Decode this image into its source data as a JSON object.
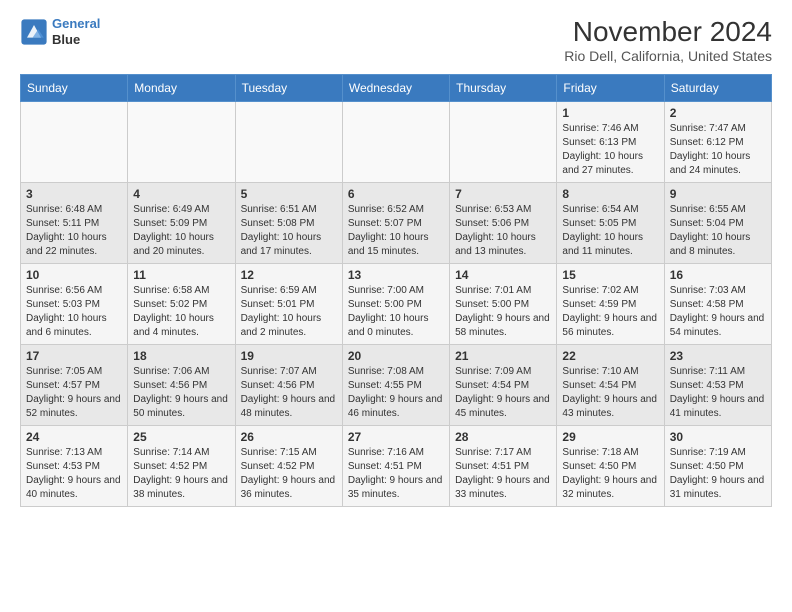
{
  "header": {
    "logo_line1": "General",
    "logo_line2": "Blue",
    "title": "November 2024",
    "subtitle": "Rio Dell, California, United States"
  },
  "weekdays": [
    "Sunday",
    "Monday",
    "Tuesday",
    "Wednesday",
    "Thursday",
    "Friday",
    "Saturday"
  ],
  "weeks": [
    [
      {
        "day": "",
        "info": ""
      },
      {
        "day": "",
        "info": ""
      },
      {
        "day": "",
        "info": ""
      },
      {
        "day": "",
        "info": ""
      },
      {
        "day": "",
        "info": ""
      },
      {
        "day": "1",
        "info": "Sunrise: 7:46 AM\nSunset: 6:13 PM\nDaylight: 10 hours and 27 minutes."
      },
      {
        "day": "2",
        "info": "Sunrise: 7:47 AM\nSunset: 6:12 PM\nDaylight: 10 hours and 24 minutes."
      }
    ],
    [
      {
        "day": "3",
        "info": "Sunrise: 6:48 AM\nSunset: 5:11 PM\nDaylight: 10 hours and 22 minutes."
      },
      {
        "day": "4",
        "info": "Sunrise: 6:49 AM\nSunset: 5:09 PM\nDaylight: 10 hours and 20 minutes."
      },
      {
        "day": "5",
        "info": "Sunrise: 6:51 AM\nSunset: 5:08 PM\nDaylight: 10 hours and 17 minutes."
      },
      {
        "day": "6",
        "info": "Sunrise: 6:52 AM\nSunset: 5:07 PM\nDaylight: 10 hours and 15 minutes."
      },
      {
        "day": "7",
        "info": "Sunrise: 6:53 AM\nSunset: 5:06 PM\nDaylight: 10 hours and 13 minutes."
      },
      {
        "day": "8",
        "info": "Sunrise: 6:54 AM\nSunset: 5:05 PM\nDaylight: 10 hours and 11 minutes."
      },
      {
        "day": "9",
        "info": "Sunrise: 6:55 AM\nSunset: 5:04 PM\nDaylight: 10 hours and 8 minutes."
      }
    ],
    [
      {
        "day": "10",
        "info": "Sunrise: 6:56 AM\nSunset: 5:03 PM\nDaylight: 10 hours and 6 minutes."
      },
      {
        "day": "11",
        "info": "Sunrise: 6:58 AM\nSunset: 5:02 PM\nDaylight: 10 hours and 4 minutes."
      },
      {
        "day": "12",
        "info": "Sunrise: 6:59 AM\nSunset: 5:01 PM\nDaylight: 10 hours and 2 minutes."
      },
      {
        "day": "13",
        "info": "Sunrise: 7:00 AM\nSunset: 5:00 PM\nDaylight: 10 hours and 0 minutes."
      },
      {
        "day": "14",
        "info": "Sunrise: 7:01 AM\nSunset: 5:00 PM\nDaylight: 9 hours and 58 minutes."
      },
      {
        "day": "15",
        "info": "Sunrise: 7:02 AM\nSunset: 4:59 PM\nDaylight: 9 hours and 56 minutes."
      },
      {
        "day": "16",
        "info": "Sunrise: 7:03 AM\nSunset: 4:58 PM\nDaylight: 9 hours and 54 minutes."
      }
    ],
    [
      {
        "day": "17",
        "info": "Sunrise: 7:05 AM\nSunset: 4:57 PM\nDaylight: 9 hours and 52 minutes."
      },
      {
        "day": "18",
        "info": "Sunrise: 7:06 AM\nSunset: 4:56 PM\nDaylight: 9 hours and 50 minutes."
      },
      {
        "day": "19",
        "info": "Sunrise: 7:07 AM\nSunset: 4:56 PM\nDaylight: 9 hours and 48 minutes."
      },
      {
        "day": "20",
        "info": "Sunrise: 7:08 AM\nSunset: 4:55 PM\nDaylight: 9 hours and 46 minutes."
      },
      {
        "day": "21",
        "info": "Sunrise: 7:09 AM\nSunset: 4:54 PM\nDaylight: 9 hours and 45 minutes."
      },
      {
        "day": "22",
        "info": "Sunrise: 7:10 AM\nSunset: 4:54 PM\nDaylight: 9 hours and 43 minutes."
      },
      {
        "day": "23",
        "info": "Sunrise: 7:11 AM\nSunset: 4:53 PM\nDaylight: 9 hours and 41 minutes."
      }
    ],
    [
      {
        "day": "24",
        "info": "Sunrise: 7:13 AM\nSunset: 4:53 PM\nDaylight: 9 hours and 40 minutes."
      },
      {
        "day": "25",
        "info": "Sunrise: 7:14 AM\nSunset: 4:52 PM\nDaylight: 9 hours and 38 minutes."
      },
      {
        "day": "26",
        "info": "Sunrise: 7:15 AM\nSunset: 4:52 PM\nDaylight: 9 hours and 36 minutes."
      },
      {
        "day": "27",
        "info": "Sunrise: 7:16 AM\nSunset: 4:51 PM\nDaylight: 9 hours and 35 minutes."
      },
      {
        "day": "28",
        "info": "Sunrise: 7:17 AM\nSunset: 4:51 PM\nDaylight: 9 hours and 33 minutes."
      },
      {
        "day": "29",
        "info": "Sunrise: 7:18 AM\nSunset: 4:50 PM\nDaylight: 9 hours and 32 minutes."
      },
      {
        "day": "30",
        "info": "Sunrise: 7:19 AM\nSunset: 4:50 PM\nDaylight: 9 hours and 31 minutes."
      }
    ]
  ]
}
